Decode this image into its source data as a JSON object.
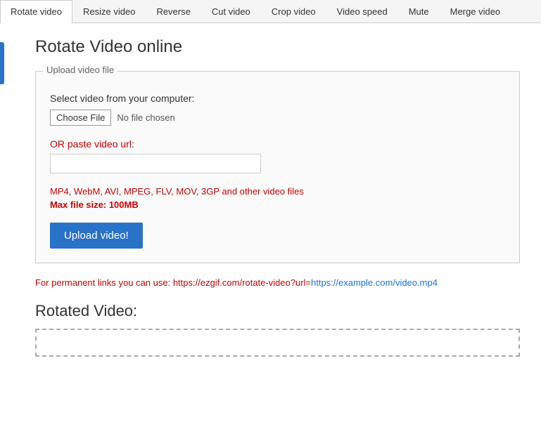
{
  "tabs": [
    {
      "id": "rotate",
      "label": "Rotate video",
      "active": true
    },
    {
      "id": "resize",
      "label": "Resize video",
      "active": false
    },
    {
      "id": "reverse",
      "label": "Reverse",
      "active": false
    },
    {
      "id": "cut",
      "label": "Cut video",
      "active": false
    },
    {
      "id": "crop",
      "label": "Crop video",
      "active": false
    },
    {
      "id": "speed",
      "label": "Video speed",
      "active": false
    },
    {
      "id": "mute",
      "label": "Mute",
      "active": false
    },
    {
      "id": "merge",
      "label": "Merge video",
      "active": false
    }
  ],
  "page": {
    "title": "Rotate Video online",
    "upload_box_legend": "Upload video file",
    "select_label": "Select video from your computer:",
    "choose_file_label": "Choose File",
    "no_file_text": "No file chosen",
    "or_paste_label": "OR paste video url:",
    "url_placeholder": "",
    "formats_text": "MP4, WebM, AVI, MPEG, FLV, MOV, 3GP and other video files",
    "maxsize_prefix": "Max file size: ",
    "maxsize_value": "100MB",
    "upload_btn_label": "Upload video!",
    "permanent_link_prefix": "For permanent links you can use: https://ezgif.com/rotate-video?url=",
    "permanent_link_example": "https://example.com/video.mp4",
    "rotated_title": "Rotated Video:"
  }
}
